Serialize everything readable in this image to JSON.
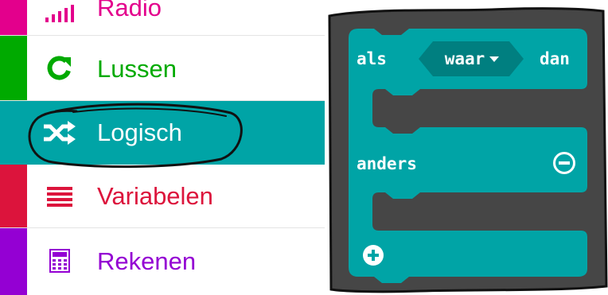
{
  "toolbox": {
    "categories": [
      {
        "label": "Radio",
        "color": "#e3008c"
      },
      {
        "label": "Lussen",
        "color": "#00aa00"
      },
      {
        "label": "Logisch",
        "color": "#00a4a6"
      },
      {
        "label": "Variabelen",
        "color": "#dc143c"
      },
      {
        "label": "Rekenen",
        "color": "#9400d3"
      }
    ],
    "selected": "Logisch"
  },
  "block": {
    "if_label": "als",
    "condition": "waar",
    "then_label": "dan",
    "else_label": "anders",
    "color": "#00a4a6",
    "dark_color": "#007f80",
    "background": "#464646"
  }
}
